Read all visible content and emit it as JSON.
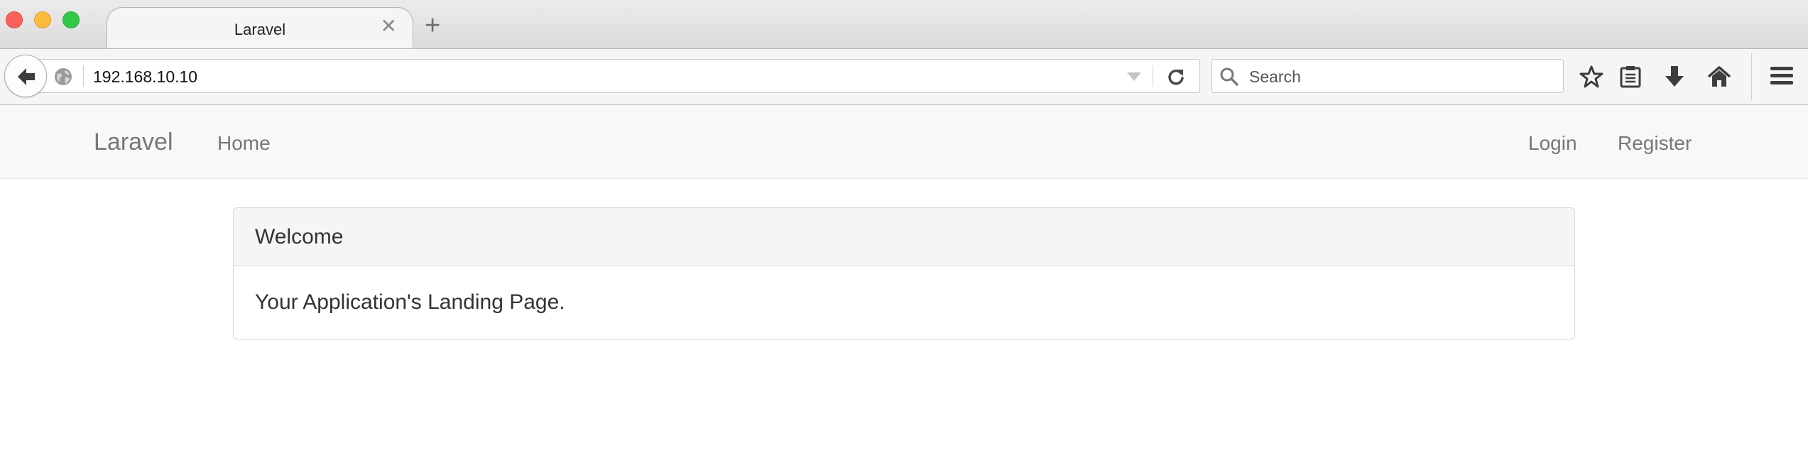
{
  "browser": {
    "tab_title": "Laravel",
    "tab_close_glyph": "✕",
    "new_tab_glyph": "+",
    "url": "192.168.10.10",
    "search_placeholder": "Search",
    "icons": {
      "back": "arrow-left-icon",
      "site_identity": "globe-icon",
      "url_dropdown": "chevron-down-icon",
      "reload": "reload-icon",
      "search": "search-icon",
      "bookmark": "star-icon",
      "reading_list": "clipboard-icon",
      "downloads": "download-icon",
      "home": "home-icon",
      "menu": "hamburger-menu-icon"
    },
    "traffic_lights": {
      "close": "#fc605c",
      "minimize": "#fdbc40",
      "maximize": "#34c84a"
    }
  },
  "page": {
    "navbar": {
      "brand": "Laravel",
      "left_links": [
        "Home"
      ],
      "right_links": [
        "Login",
        "Register"
      ]
    },
    "panel": {
      "heading": "Welcome",
      "body": "Your Application's Landing Page."
    }
  }
}
